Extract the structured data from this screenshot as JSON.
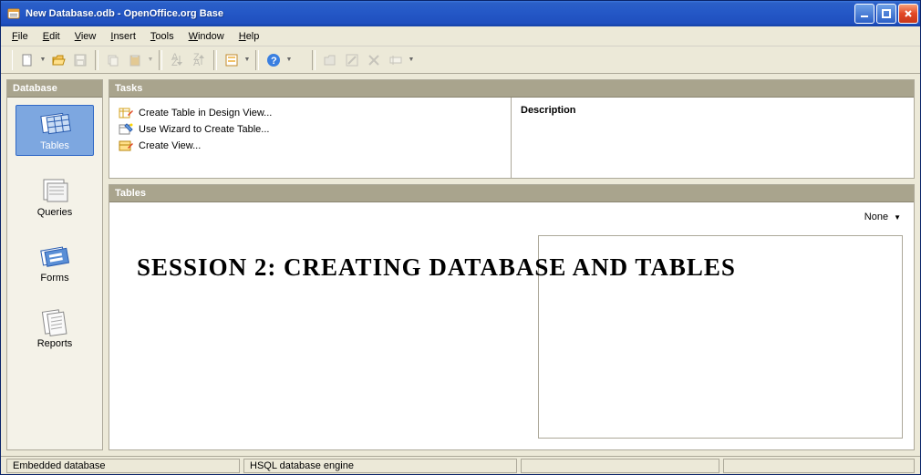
{
  "titlebar": {
    "title": "New Database.odb - OpenOffice.org Base"
  },
  "menu": {
    "file": "File",
    "edit": "Edit",
    "view": "View",
    "insert": "Insert",
    "tools": "Tools",
    "window": "Window",
    "help": "Help"
  },
  "sidebar": {
    "header": "Database",
    "items": [
      {
        "label": "Tables",
        "selected": true
      },
      {
        "label": "Queries",
        "selected": false
      },
      {
        "label": "Forms",
        "selected": false
      },
      {
        "label": "Reports",
        "selected": false
      }
    ]
  },
  "tasks": {
    "header": "Tasks",
    "items": [
      "Create Table in Design View...",
      "Use Wizard to Create Table...",
      "Create View..."
    ],
    "description_label": "Description"
  },
  "tables": {
    "header": "Tables",
    "view_mode": "None"
  },
  "overlay": "Session 2: creating database and tables",
  "statusbar": {
    "cell1": "Embedded database",
    "cell2": "HSQL database engine"
  }
}
